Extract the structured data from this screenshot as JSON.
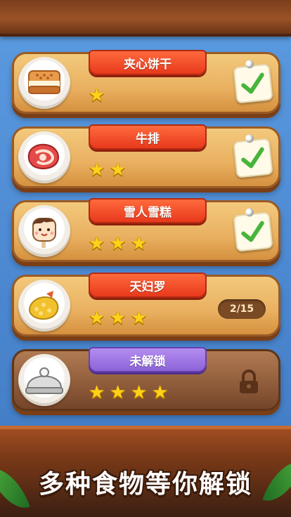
{
  "levels": [
    {
      "title": "夹心饼干",
      "food_icon": "sandwich-cookie-icon",
      "stars": 1,
      "status": "completed",
      "progress_text": ""
    },
    {
      "title": "牛排",
      "food_icon": "steak-icon",
      "stars": 2,
      "status": "completed",
      "progress_text": ""
    },
    {
      "title": "雪人雪糕",
      "food_icon": "snowman-ice-cream-icon",
      "stars": 3,
      "status": "completed",
      "progress_text": ""
    },
    {
      "title": "天妇罗",
      "food_icon": "tempura-icon",
      "stars": 3,
      "status": "in-progress",
      "progress_text": "2/15"
    },
    {
      "title": "未解锁",
      "food_icon": "covered-dish-icon",
      "stars": 4,
      "status": "locked",
      "progress_text": ""
    }
  ],
  "promo_text": "多种食物等你解锁",
  "colors": {
    "title_banner": "#e8391c",
    "locked_banner": "#8c63d8",
    "star": "#ffd21a",
    "check": "#49b43b"
  }
}
